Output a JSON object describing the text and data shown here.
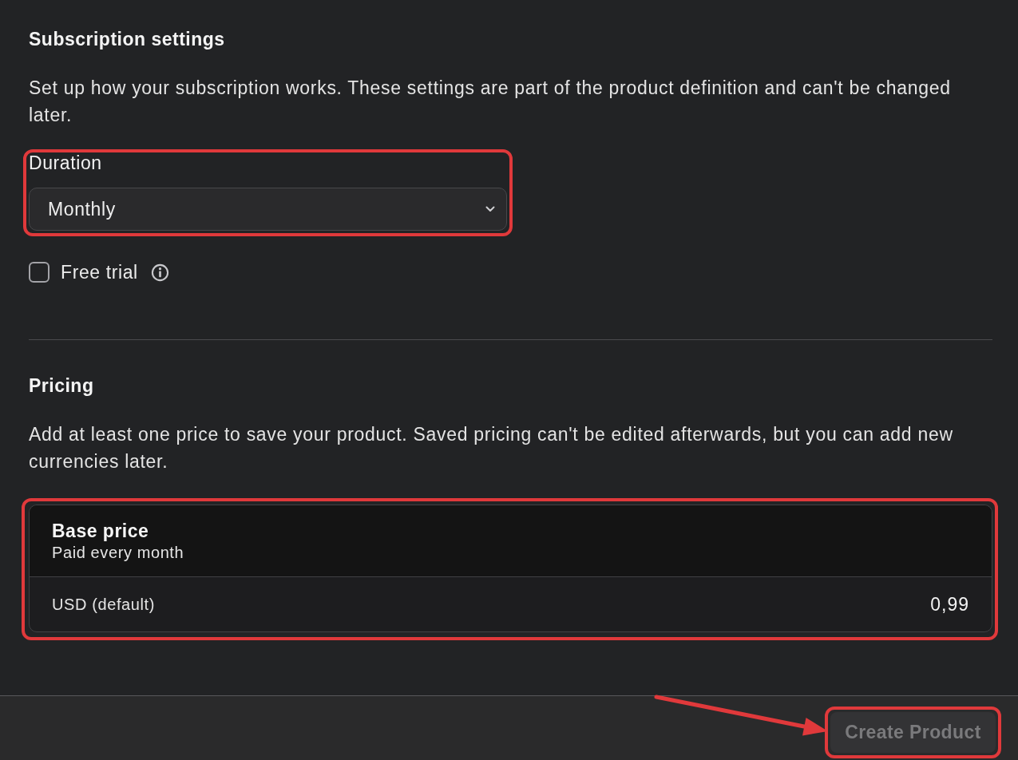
{
  "subscription_settings": {
    "title": "Subscription settings",
    "description": "Set up how your subscription works. These settings are part of the product definition and can't be changed later.",
    "duration": {
      "label": "Duration",
      "value": "Monthly",
      "highlighted": true
    },
    "free_trial": {
      "label": "Free trial",
      "checked": false
    }
  },
  "pricing": {
    "title": "Pricing",
    "description": "Add at least one price to save your product. Saved pricing can't be edited afterwards, but you can add new currencies later.",
    "price_card": {
      "title": "Base price",
      "subtitle": "Paid every month",
      "highlighted": true,
      "rows": [
        {
          "currency": "USD (default)",
          "value": "0,99"
        }
      ]
    }
  },
  "footer": {
    "button": {
      "label": "Create Product",
      "disabled": true,
      "highlighted": true
    },
    "pointer_arrow": true
  }
}
